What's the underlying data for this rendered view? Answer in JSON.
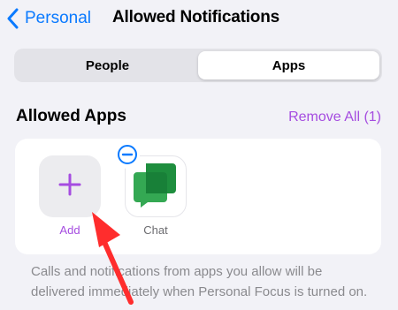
{
  "nav": {
    "back_label": "Personal",
    "title": "Allowed Notifications"
  },
  "segments": [
    {
      "label": "People",
      "selected": false
    },
    {
      "label": "Apps",
      "selected": true
    }
  ],
  "section": {
    "title": "Allowed Apps",
    "action_label": "Remove All (1)"
  },
  "apps": [
    {
      "label": "Add",
      "icon": "plus-icon"
    },
    {
      "label": "Chat",
      "icon": "google-chat-icon",
      "removable": true
    }
  ],
  "footer_text": "Calls and notifications from apps you allow will be delivered immediately when Personal Focus is turned on.",
  "colors": {
    "accent_blue": "#0a7aff",
    "accent_purple": "#a54ce0",
    "background": "#f2f2f7",
    "arrow_red": "#ff2d2d",
    "chat_green": "#34a853"
  }
}
